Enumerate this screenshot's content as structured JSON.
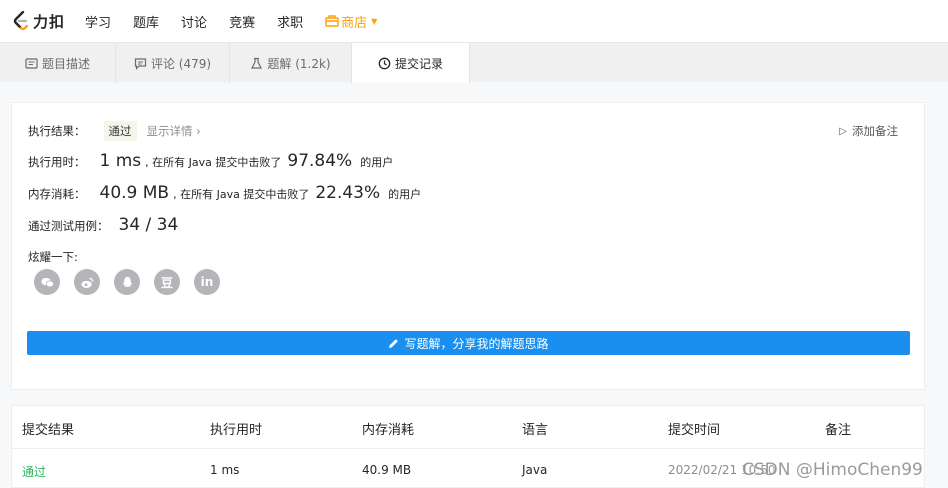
{
  "brand": {
    "name": "力扣"
  },
  "nav": {
    "items": [
      "学习",
      "题库",
      "讨论",
      "竞赛",
      "求职"
    ],
    "store": "商店"
  },
  "tabs": [
    {
      "label": "题目描述",
      "icon": "document-icon"
    },
    {
      "label": "评论 (479)",
      "icon": "comment-icon"
    },
    {
      "label": "题解 (1.2k)",
      "icon": "flask-icon"
    },
    {
      "label": "提交记录",
      "icon": "clock-icon",
      "active": true
    }
  ],
  "result": {
    "label": "执行结果：",
    "status": "通过",
    "detail_link": "显示详情 ›",
    "add_note": "添加备注",
    "runtime_label": "执行用时：",
    "runtime_value": "1 ms",
    "runtime_text": ", 在所有 Java 提交中击败了",
    "runtime_pct": "97.84%",
    "runtime_suffix": "的用户",
    "memory_label": "内存消耗：",
    "memory_value": "40.9 MB",
    "memory_text": ", 在所有 Java 提交中击败了",
    "memory_pct": "22.43%",
    "memory_suffix": "的用户",
    "tests_label": "通过测试用例：",
    "tests_value": "34 / 34",
    "share_label": "炫耀一下:",
    "share_icons": [
      "wechat-icon",
      "weibo-icon",
      "qq-icon",
      "douban-icon",
      "linkedin-icon"
    ],
    "douban_glyph": "豆",
    "linkedin_glyph": "in",
    "write_button": "写题解，分享我的解题思路"
  },
  "table": {
    "headers": [
      "提交结果",
      "执行用时",
      "内存消耗",
      "语言",
      "提交时间",
      "备注"
    ],
    "rows": [
      {
        "status": "通过",
        "runtime": "1 ms",
        "memory": "40.9 MB",
        "language": "Java",
        "time": "2022/02/21 10:50"
      }
    ]
  },
  "watermark": "CSDN @HimoChen99",
  "colors": {
    "accent": "#1a8fef",
    "pass": "#2db55d",
    "store": "#ff9f0a"
  }
}
